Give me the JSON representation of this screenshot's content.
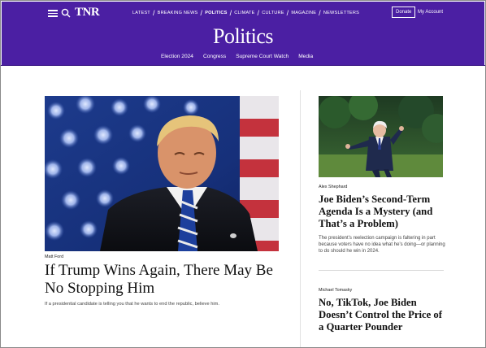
{
  "header": {
    "logo": "TNR",
    "nav": [
      {
        "label": "LATEST",
        "active": false
      },
      {
        "label": "BREAKING NEWS",
        "active": false
      },
      {
        "label": "POLITICS",
        "active": true
      },
      {
        "label": "CLIMATE",
        "active": false
      },
      {
        "label": "CULTURE",
        "active": false
      },
      {
        "label": "MAGAZINE",
        "active": false
      },
      {
        "label": "NEWSLETTERS",
        "active": false
      }
    ],
    "donate_label": "Donate",
    "account_label": "My Account",
    "section_title": "Politics",
    "subnav": [
      "Election 2024",
      "Congress",
      "Supreme Court Watch",
      "Media"
    ],
    "colors": {
      "brand": "#4b1fa3"
    }
  },
  "lead": {
    "author": "Matt Ford",
    "headline": "If Trump Wins Again, There May Be No Stopping Him",
    "dek": "If a presidential candidate is telling you that he wants to end the republic, believe him."
  },
  "side": [
    {
      "author": "Alex Shephard",
      "headline": "Joe Biden’s Second-Term Agenda Is a Mystery (and That’s a Problem)",
      "dek": "The president’s reelection campaign is faltering in part because voters have no idea what he’s doing—or planning to do should he win in 2024."
    },
    {
      "author": "Michael Tomasky",
      "headline": "No, TikTok, Joe Biden Doesn’t Control the Price of a Quarter Pounder"
    }
  ]
}
